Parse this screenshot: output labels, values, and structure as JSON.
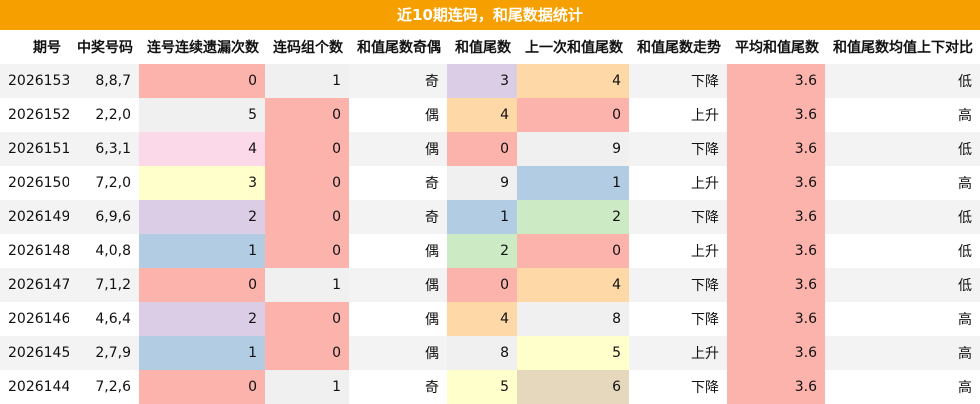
{
  "title": "近10期连码，和尾数据统计",
  "columns": [
    "期号",
    "中奖号码",
    "连号连续遗漏次数",
    "连码组个数",
    "和值尾数奇偶",
    "和值尾数",
    "上一次和值尾数",
    "和值尾数走势",
    "平均和值尾数",
    "和值尾数均值上下对比"
  ],
  "palette": {
    "header_bg": "#f5a000",
    "row_alt": "#f3f3f3",
    "red": "#fcb3ac",
    "orange": "#ffd8a8",
    "purple": "#dccde6",
    "blue": "#b2cde3",
    "green": "#ccebc5",
    "yellow": "#ffffcc",
    "pink": "#fcd9e8",
    "tan": "#e5d8bd",
    "light": "#f0f0f0"
  },
  "rows": [
    {
      "cells": [
        "2026153",
        "8,8,7",
        "0",
        "1",
        "奇",
        "3",
        "4",
        "下降",
        "3.6",
        "低"
      ],
      "colors": [
        null,
        null,
        "red",
        "light",
        null,
        "purple",
        "orange",
        null,
        "red",
        null
      ]
    },
    {
      "cells": [
        "2026152",
        "2,2,0",
        "5",
        "0",
        "偶",
        "4",
        "0",
        "上升",
        "3.6",
        "高"
      ],
      "colors": [
        null,
        null,
        "light",
        "red",
        null,
        "orange",
        "red",
        null,
        "red",
        null
      ]
    },
    {
      "cells": [
        "2026151",
        "6,3,1",
        "4",
        "0",
        "偶",
        "0",
        "9",
        "下降",
        "3.6",
        "低"
      ],
      "colors": [
        null,
        null,
        "pink",
        "red",
        null,
        "red",
        "light",
        null,
        "red",
        null
      ]
    },
    {
      "cells": [
        "2026150",
        "7,2,0",
        "3",
        "0",
        "奇",
        "9",
        "1",
        "上升",
        "3.6",
        "高"
      ],
      "colors": [
        null,
        null,
        "yellow",
        "red",
        null,
        "light",
        "blue",
        null,
        "red",
        null
      ]
    },
    {
      "cells": [
        "2026149",
        "6,9,6",
        "2",
        "0",
        "奇",
        "1",
        "2",
        "下降",
        "3.6",
        "低"
      ],
      "colors": [
        null,
        null,
        "purple",
        "red",
        null,
        "blue",
        "green",
        null,
        "red",
        null
      ]
    },
    {
      "cells": [
        "2026148",
        "4,0,8",
        "1",
        "0",
        "偶",
        "2",
        "0",
        "上升",
        "3.6",
        "低"
      ],
      "colors": [
        null,
        null,
        "blue",
        "red",
        null,
        "green",
        "red",
        null,
        "red",
        null
      ]
    },
    {
      "cells": [
        "2026147",
        "7,1,2",
        "0",
        "1",
        "偶",
        "0",
        "4",
        "下降",
        "3.6",
        "低"
      ],
      "colors": [
        null,
        null,
        "red",
        "light",
        null,
        "red",
        "orange",
        null,
        "red",
        null
      ]
    },
    {
      "cells": [
        "2026146",
        "4,6,4",
        "2",
        "0",
        "偶",
        "4",
        "8",
        "下降",
        "3.6",
        "高"
      ],
      "colors": [
        null,
        null,
        "purple",
        "red",
        null,
        "orange",
        "light",
        null,
        "red",
        null
      ]
    },
    {
      "cells": [
        "2026145",
        "2,7,9",
        "1",
        "0",
        "偶",
        "8",
        "5",
        "上升",
        "3.6",
        "高"
      ],
      "colors": [
        null,
        null,
        "blue",
        "red",
        null,
        "light",
        "yellow",
        null,
        "red",
        null
      ]
    },
    {
      "cells": [
        "2026144",
        "7,2,6",
        "0",
        "1",
        "奇",
        "5",
        "6",
        "下降",
        "3.6",
        "高"
      ],
      "colors": [
        null,
        null,
        "red",
        "light",
        null,
        "yellow",
        "tan",
        null,
        "red",
        null
      ]
    }
  ]
}
